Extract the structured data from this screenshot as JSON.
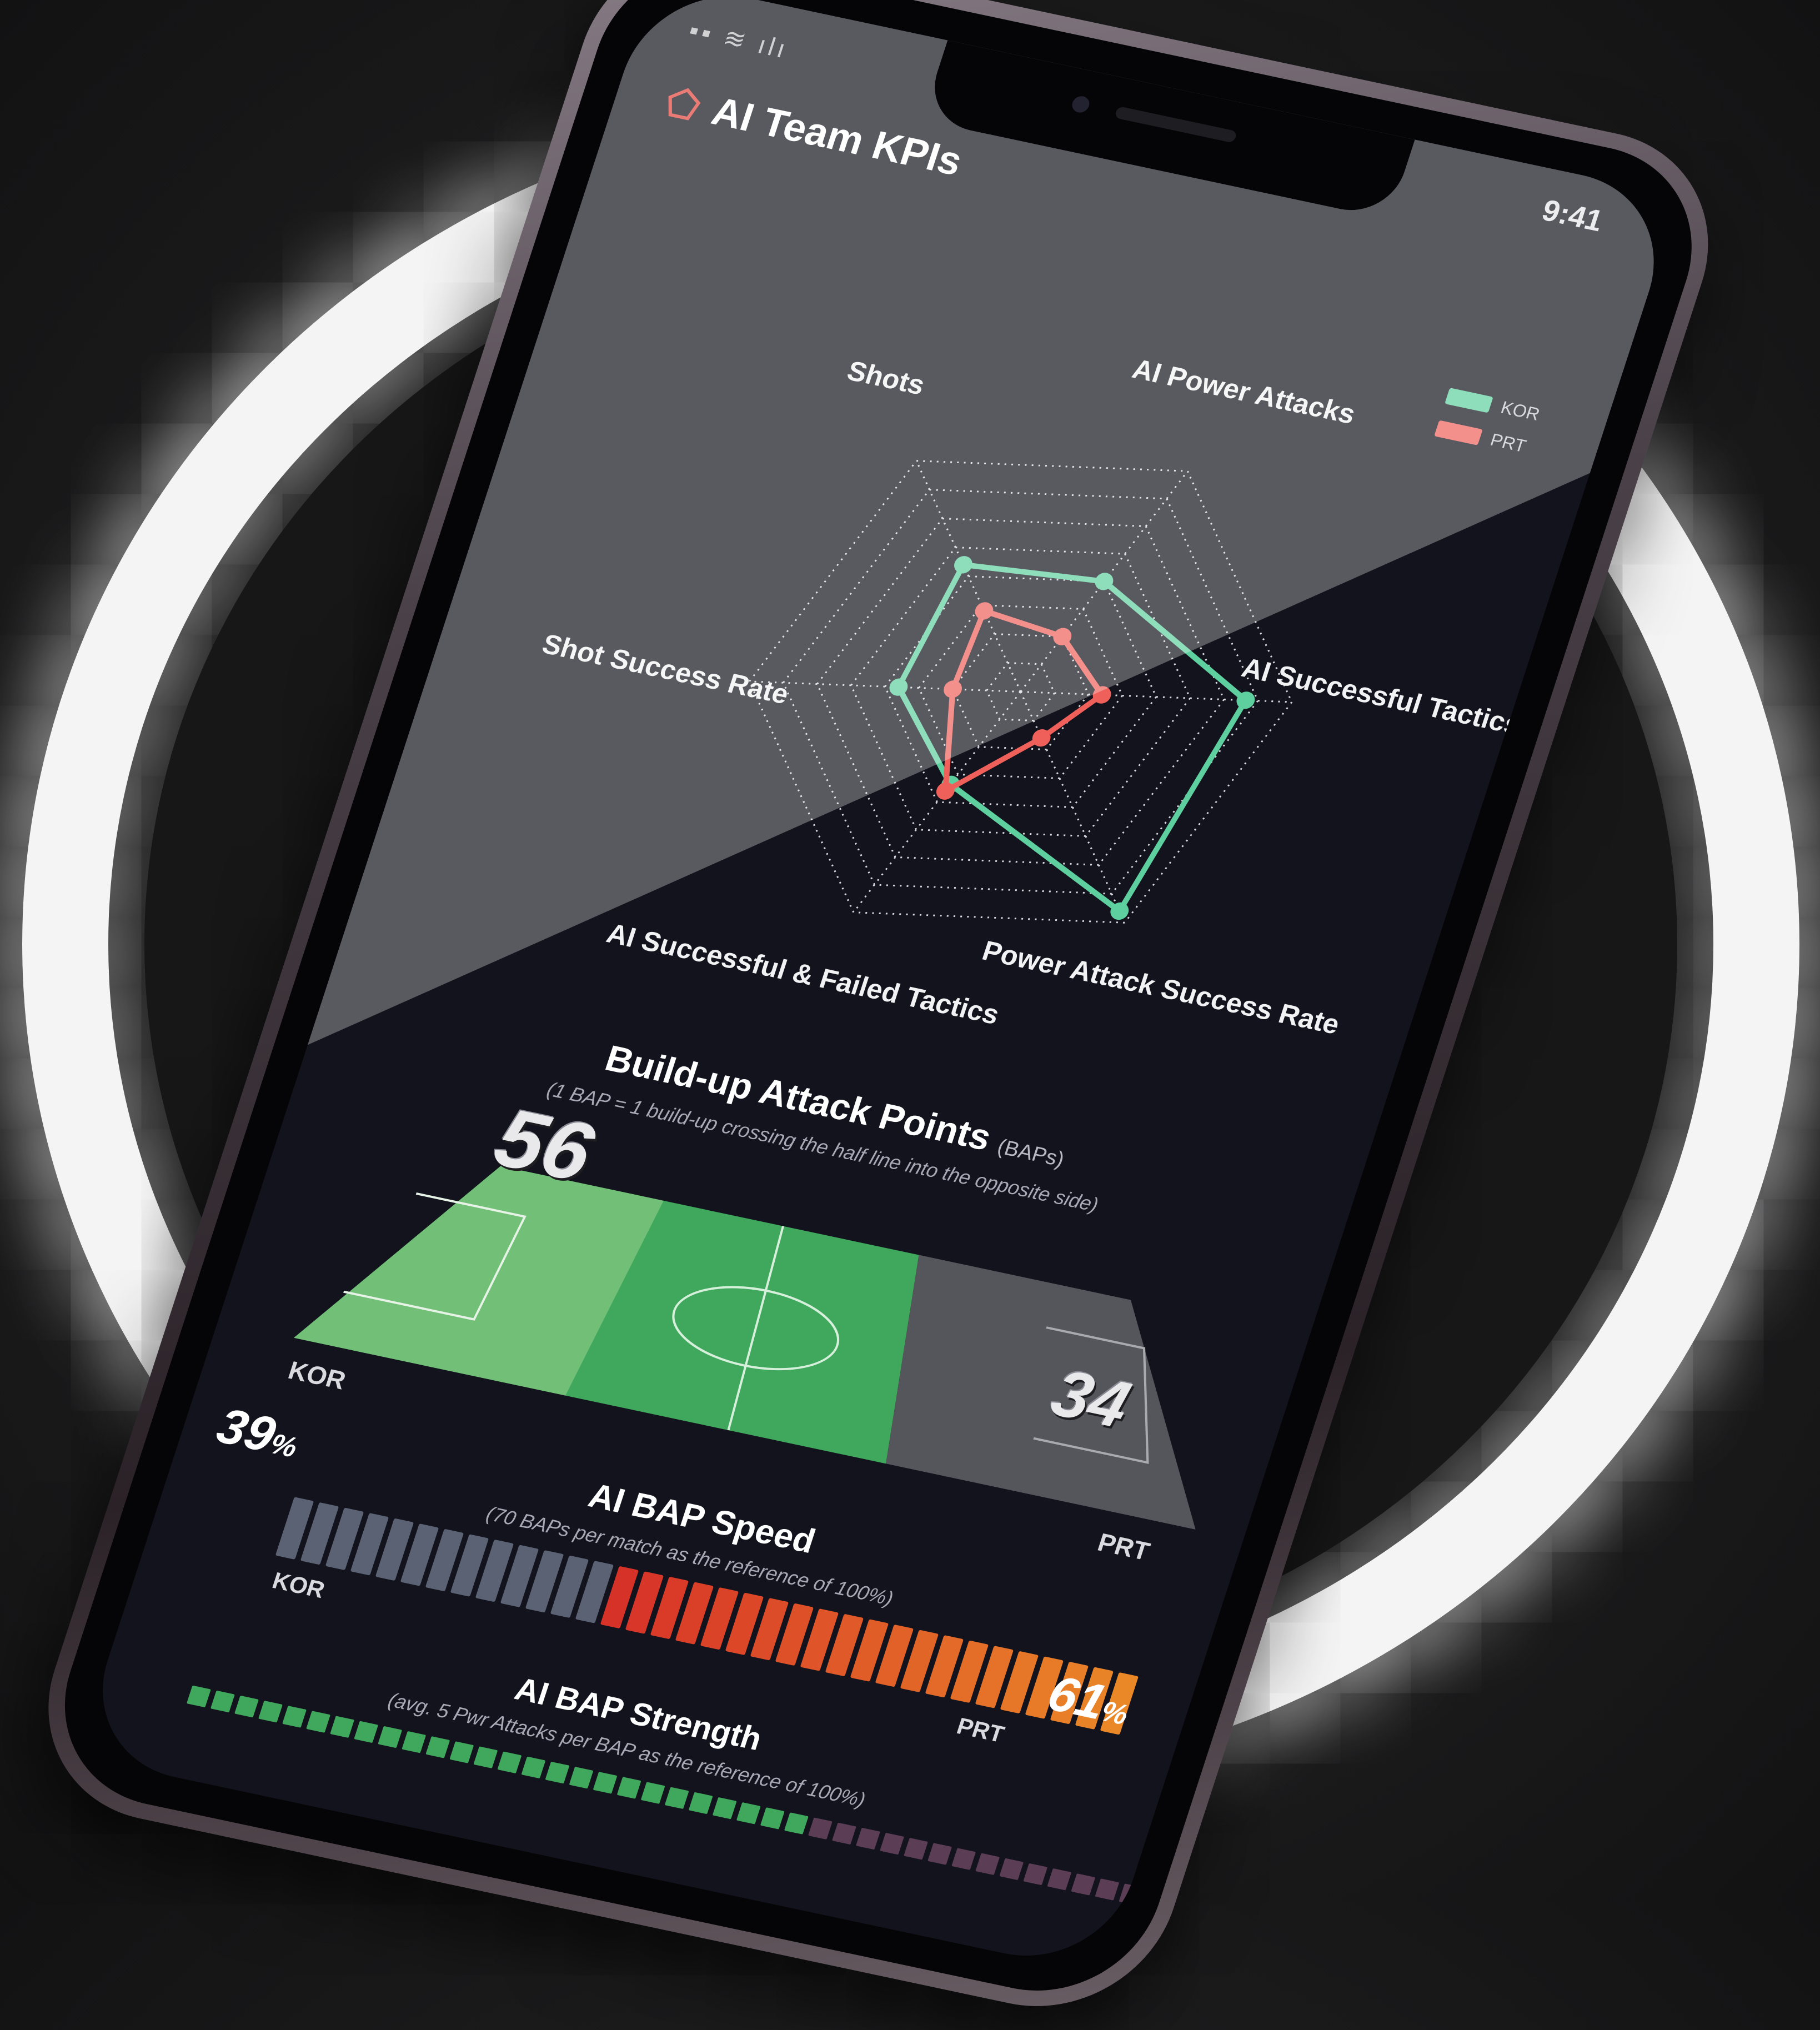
{
  "app": {
    "title": "AI Team KPIs",
    "status_left": "▪▪ ≋ ılı",
    "status_time": "9:41"
  },
  "colors": {
    "kor": "#5ed0a0",
    "prt": "#f0605a",
    "accent": "#e2433a"
  },
  "legend": [
    {
      "label": "KOR",
      "color": "#5ed0a0"
    },
    {
      "label": "PRT",
      "color": "#f0605a"
    }
  ],
  "radar": {
    "axes": [
      "AI Power Attacks",
      "AI Successful Tactics",
      "Power Attack Success Rate",
      "AI Successful & Failed Tactics",
      "Shot Success Rate",
      "Shots"
    ],
    "series": [
      {
        "name": "KOR",
        "values": [
          0.5,
          0.83,
          0.95,
          0.42,
          0.45,
          0.55
        ]
      },
      {
        "name": "PRT",
        "values": [
          0.25,
          0.3,
          0.2,
          0.45,
          0.25,
          0.35
        ]
      }
    ]
  },
  "build_up": {
    "title": "Build-up Attack Points",
    "unit": "(BAPs)",
    "note": "(1 BAP = 1 build-up crossing the half line into the opposite side)",
    "kor_value": "56",
    "prt_value": "34",
    "kor_label": "KOR",
    "prt_label": "PRT"
  },
  "bap_speed": {
    "title": "AI BAP Speed",
    "note": "(70 BAPs per match as the reference of 100%)",
    "kor_pct": "39",
    "prt_pct": "61",
    "pct_symbol": "%",
    "kor_label": "KOR",
    "prt_label": "PRT"
  },
  "bap_strength": {
    "title": "AI BAP Strength",
    "note": "(avg. 5 Pwr Attacks per BAP as the reference of 100%)"
  }
}
